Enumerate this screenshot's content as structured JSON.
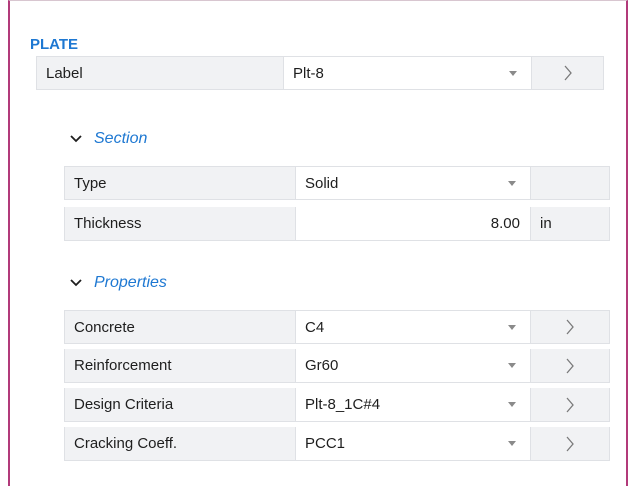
{
  "plate": {
    "title": "PLATE",
    "label_name": "Label",
    "label_value": "Plt-8"
  },
  "section": {
    "heading": "Section",
    "rows": [
      {
        "name": "Type",
        "value": "Solid"
      },
      {
        "name": "Thickness",
        "value": "8.00",
        "unit": "in"
      }
    ]
  },
  "properties": {
    "heading": "Properties",
    "rows": [
      {
        "name": "Concrete",
        "value": "C4"
      },
      {
        "name": "Reinforcement",
        "value": "Gr60"
      },
      {
        "name": "Design Criteria",
        "value": "Plt-8_1C#4"
      },
      {
        "name": "Cracking Coeff.",
        "value": "PCC1"
      }
    ]
  },
  "icons": {
    "dropdown": "chevron-down-icon",
    "navigate": "chevron-right-icon",
    "collapse": "collapse-chevron-icon"
  },
  "colors": {
    "accent": "#1e78d2",
    "frame": "#b23a7a",
    "label_bg": "#f1f2f4"
  }
}
